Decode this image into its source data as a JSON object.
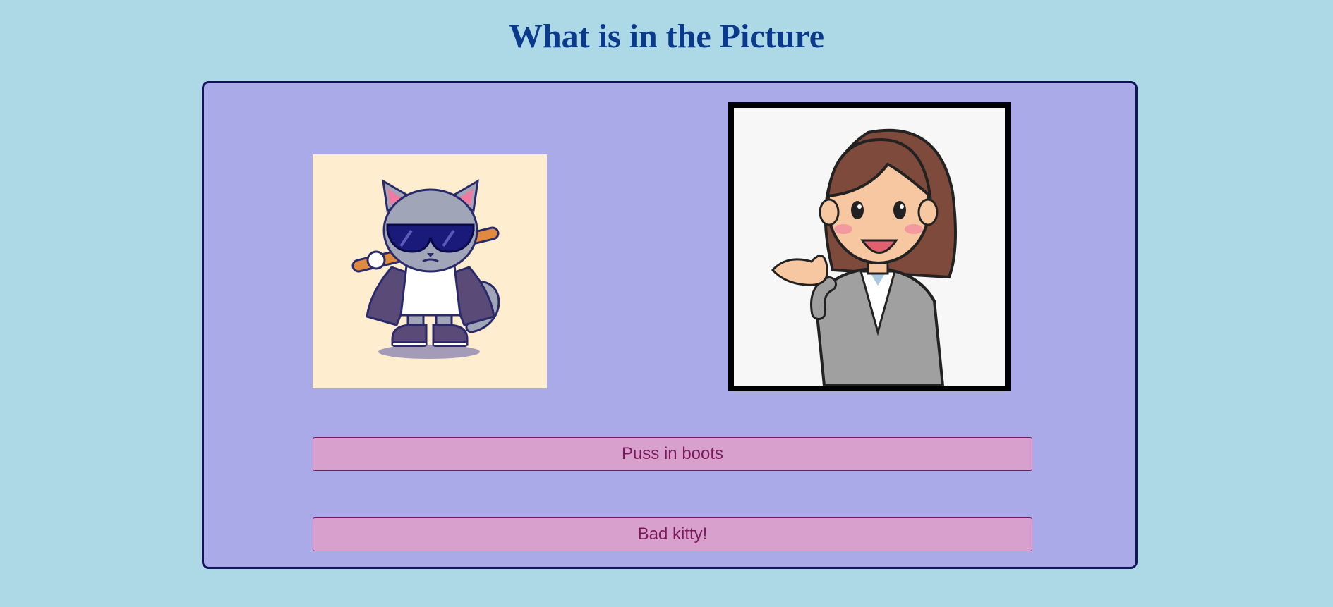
{
  "header": {
    "title": "What is in the Picture"
  },
  "pictures": [
    {
      "icon": "cat-with-bat-icon",
      "background": "#ffedd0"
    },
    {
      "icon": "waving-woman-icon",
      "background": "#f7f7f7",
      "frame": "#000000"
    }
  ],
  "answers": [
    {
      "label": "Puss in boots"
    },
    {
      "label": "Bad kitty!"
    }
  ],
  "colors": {
    "page_background": "#add8e6",
    "title": "#0a3a8c",
    "panel_background": "#aaaae8",
    "panel_border": "#14145a",
    "button_background": "#d8a0cc",
    "button_text": "#7a1a5a"
  }
}
